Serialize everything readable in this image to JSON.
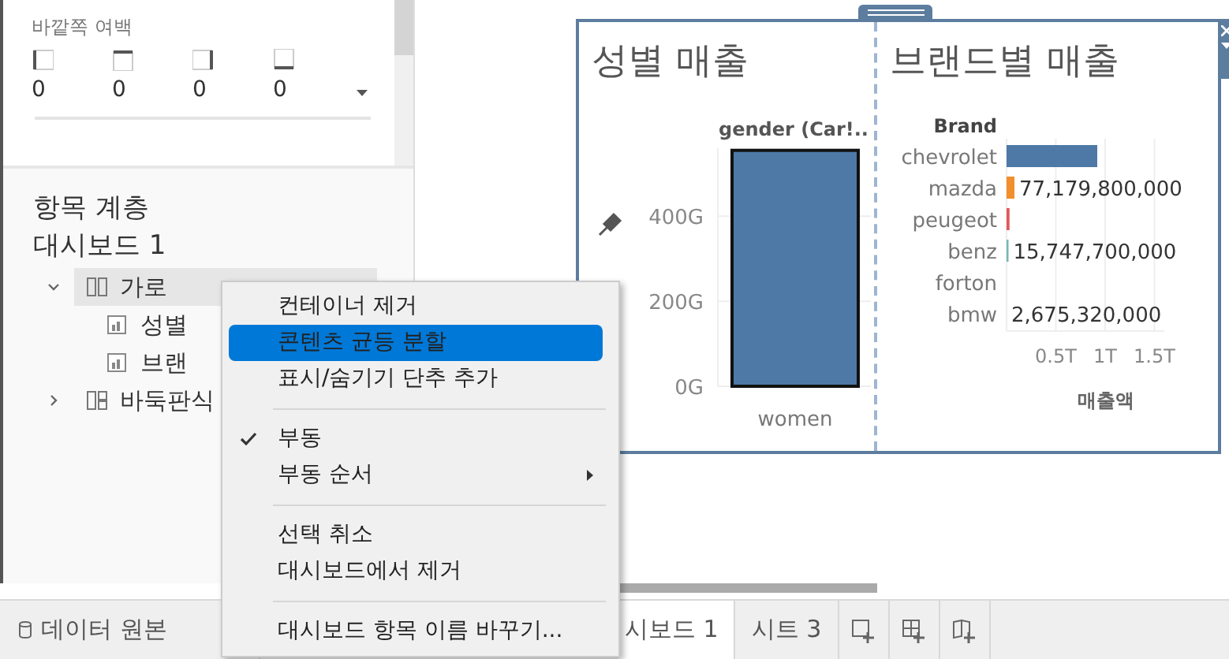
{
  "left_panel": {
    "outer_margin": {
      "label": "바깥쪽 여백",
      "values": [
        "0",
        "0",
        "0",
        "0"
      ]
    },
    "hierarchy": {
      "title": "항목 계층",
      "root": "대시보드 1",
      "items": [
        {
          "label": "가로",
          "kind": "horizontal",
          "expanded": true,
          "selected": true,
          "children": [
            {
              "label": "성별",
              "kind": "sheet",
              "selected": false
            },
            {
              "label": "브랜",
              "kind": "sheet",
              "selected": false
            }
          ]
        },
        {
          "label": "바둑판식",
          "kind": "tiled",
          "expanded": false,
          "selected": false
        }
      ]
    }
  },
  "dashboard": {
    "panels": [
      {
        "title": "성별 매출",
        "chart_data": {
          "type": "bar",
          "title": "gender (Car!..",
          "categories": [
            "women"
          ],
          "series": [
            {
              "color": "#4e79a7",
              "values": [
                555
              ]
            }
          ],
          "ylim": [
            0,
            560
          ],
          "yticks": [
            {
              "value": 0,
              "label": "0G"
            },
            {
              "value": 200,
              "label": "200G"
            },
            {
              "value": 400,
              "label": "400G"
            }
          ]
        }
      },
      {
        "title": "브랜드별 매출",
        "chart_data": {
          "type": "bar",
          "orientation": "horizontal",
          "ylabel": "Brand",
          "xlabel": "매출액",
          "categories": [
            "chevrolet",
            "mazda",
            "peugeot",
            "benz",
            "forton",
            "bmw"
          ],
          "stacked": true,
          "grid": true,
          "series": [
            {
              "color": "#4e79a7",
              "values": [
                0.92,
                null,
                null,
                null,
                null,
                null
              ]
            },
            {
              "color": "#f28e2b",
              "values": [
                null,
                0.08,
                null,
                null,
                null,
                null
              ]
            },
            {
              "color": "#e15759",
              "values": [
                null,
                null,
                0.03,
                null,
                null,
                null
              ]
            },
            {
              "color": "#76b7b2",
              "values": [
                null,
                null,
                null,
                0.02,
                null,
                null
              ]
            }
          ],
          "xlim": [
            0,
            1.6
          ],
          "value_labels": [
            null,
            "77,179,800,000",
            null,
            "15,747,700,000",
            null,
            "2,675,320,000"
          ],
          "xticks": [
            {
              "value": 0.5,
              "label": "0.5T"
            },
            {
              "value": 1,
              "label": "1T"
            },
            {
              "value": 1.5,
              "label": "1.5T"
            }
          ]
        }
      }
    ]
  },
  "context_menu": {
    "groups": [
      [
        {
          "label": "컨테이너 제거",
          "selected": false
        },
        {
          "label": "콘텐츠 균등 분할",
          "selected": true
        },
        {
          "label": "표시/숨기기 단추 추가",
          "selected": false
        }
      ],
      [
        {
          "label": "부동",
          "selected": false,
          "checked": true
        },
        {
          "label": "부동 순서",
          "selected": false,
          "submenu": true
        }
      ],
      [
        {
          "label": "선택 취소",
          "selected": false
        },
        {
          "label": "대시보드에서 제거",
          "selected": false
        }
      ],
      [
        {
          "label": "대시보드 항목 이름 바꾸기...",
          "selected": false
        }
      ]
    ]
  },
  "sheet_tabs": [
    {
      "label": "데이터 원본",
      "kind": "data_source",
      "selected": false
    },
    {
      "label": "시보드 1",
      "kind": "dashboard",
      "selected": true
    },
    {
      "label": "시트 3",
      "kind": "sheet",
      "selected": false
    }
  ]
}
